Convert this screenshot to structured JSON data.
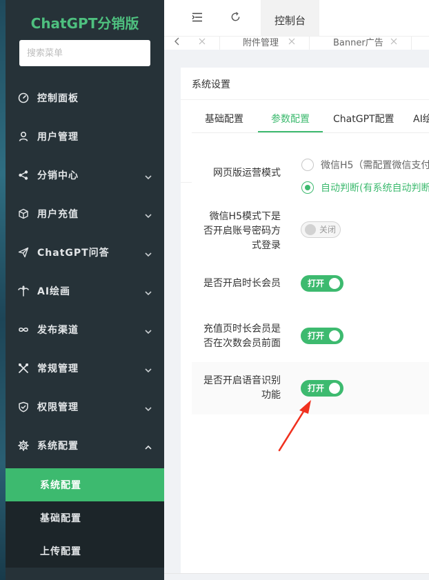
{
  "app": {
    "title": "ChatGPT分销版"
  },
  "search": {
    "placeholder": "搜索菜单"
  },
  "sidebar": {
    "items": [
      {
        "label": "控制面板",
        "icon": "dashboard-icon"
      },
      {
        "label": "用户管理",
        "icon": "user-icon"
      },
      {
        "label": "分销中心",
        "icon": "share-icon"
      },
      {
        "label": "用户充值",
        "icon": "box-icon"
      },
      {
        "label": "ChatGPT问答",
        "icon": "send-icon"
      },
      {
        "label": "AI绘画",
        "icon": "palm-icon"
      },
      {
        "label": "发布渠道",
        "icon": "infinity-icon"
      },
      {
        "label": "常规管理",
        "icon": "tools-icon"
      },
      {
        "label": "权限管理",
        "icon": "shield-icon"
      },
      {
        "label": "系统配置",
        "icon": "gear-icon"
      }
    ],
    "subitems": [
      {
        "label": "系统配置",
        "active": true
      },
      {
        "label": "基础配置",
        "active": false
      },
      {
        "label": "上传配置",
        "active": false
      }
    ]
  },
  "header": {
    "console_tab": "控制台"
  },
  "tabstrip": {
    "tab1": "附件管理",
    "tab2": "Banner广告"
  },
  "card": {
    "title": "系统设置",
    "tabs": [
      "基础配置",
      "参数配置",
      "ChatGPT配置",
      "AI绘"
    ],
    "active_tab": "参数配置"
  },
  "form": {
    "mode_label": "网页版运营模式",
    "mode_option1": "微信H5（需配置微信支付",
    "mode_option2": "自动判断(有系统自动判断",
    "pwd_label": "微信H5模式下是否开启账号密码方式登录",
    "pwd_state": "关闭",
    "member_label": "是否开启时长会员",
    "member_state": "打开",
    "order_label": "充值页时长会员是否在次数会员前面",
    "order_state": "打开",
    "voice_label": "是否开启语音识别功能",
    "voice_state": "打开"
  },
  "colors": {
    "accent": "#3dba6f",
    "sidebar_bg": "#263238",
    "logo": "#4ec07f"
  }
}
